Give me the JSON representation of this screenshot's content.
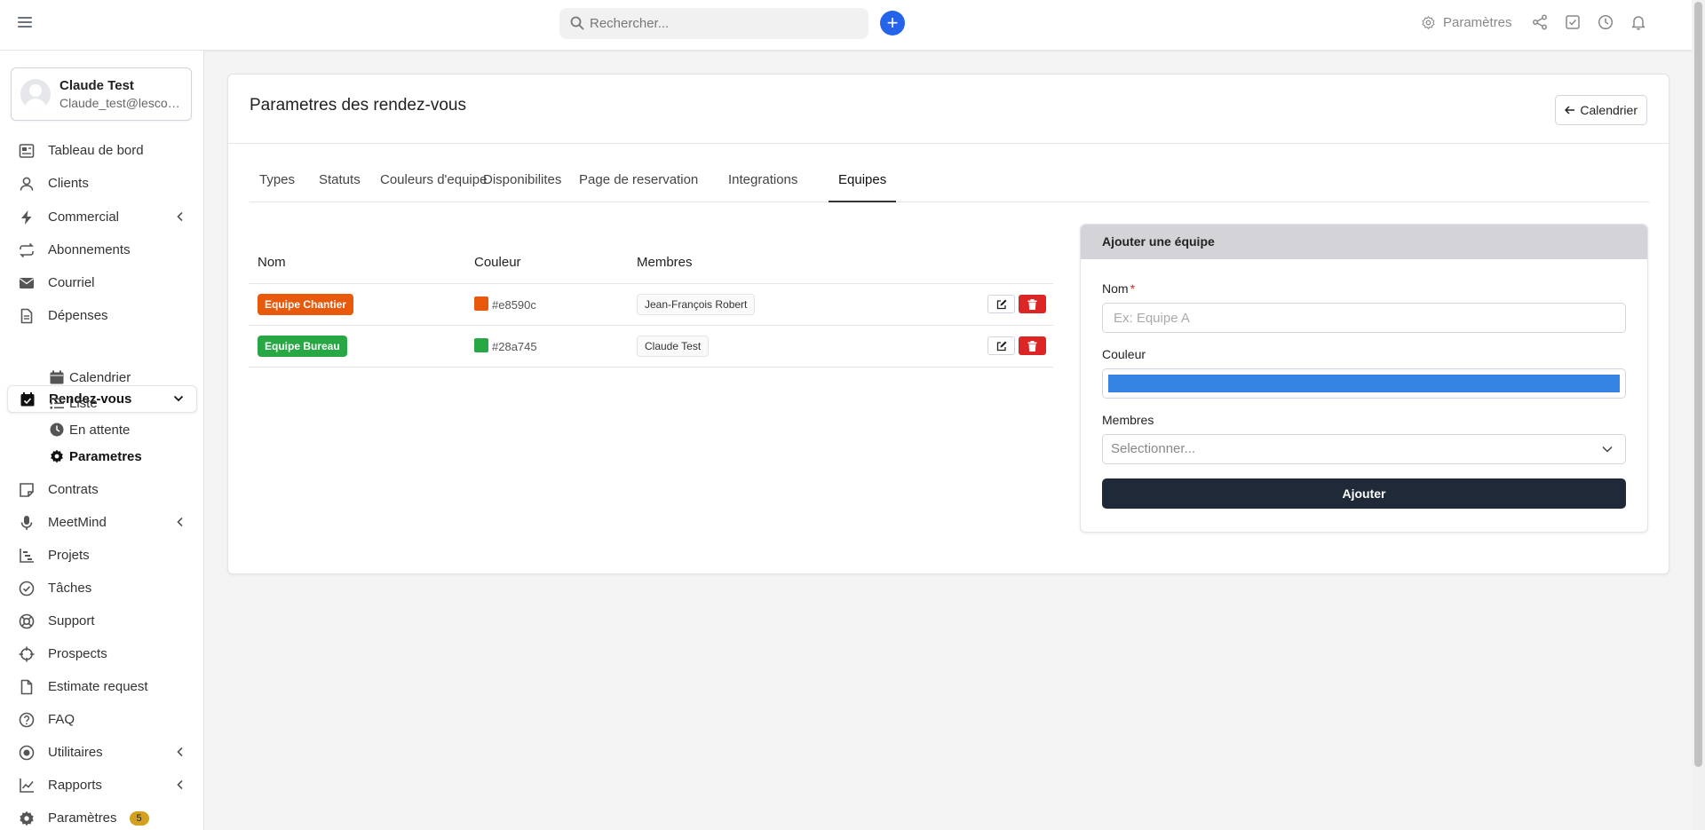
{
  "topbar": {
    "search_placeholder": "Rechercher...",
    "settings_label": "Paramètres"
  },
  "user": {
    "name": "Claude Test",
    "email": "Claude_test@lescom..."
  },
  "sidebar": {
    "items": [
      {
        "label": "Tableau de bord",
        "icon": "dashboard-icon"
      },
      {
        "label": "Clients",
        "icon": "user-icon"
      },
      {
        "label": "Commercial",
        "icon": "bolt-icon"
      },
      {
        "label": "Abonnements",
        "icon": "repeat-icon"
      },
      {
        "label": "Courriel",
        "icon": "mail-icon"
      },
      {
        "label": "Dépenses",
        "icon": "receipt-icon"
      },
      {
        "label": "Rendez-vous",
        "icon": "calendar-check-icon"
      },
      {
        "label": "Contrats",
        "icon": "note-icon"
      },
      {
        "label": "MeetMind",
        "icon": "microphone-icon"
      },
      {
        "label": "Projets",
        "icon": "chart-steps-icon"
      },
      {
        "label": "Tâches",
        "icon": "check-circle-icon"
      },
      {
        "label": "Support",
        "icon": "lifebuoy-icon"
      },
      {
        "label": "Prospects",
        "icon": "crosshair-icon"
      },
      {
        "label": "Estimate request",
        "icon": "file-icon"
      },
      {
        "label": "FAQ",
        "icon": "question-icon"
      },
      {
        "label": "Utilitaires",
        "icon": "radio-icon"
      },
      {
        "label": "Rapports",
        "icon": "line-chart-icon"
      },
      {
        "label": "Paramètres",
        "icon": "gear-icon",
        "badge": "5"
      }
    ],
    "sub_items": [
      {
        "label": "Calendrier",
        "icon": "calendar-icon"
      },
      {
        "label": "Liste",
        "icon": "list-icon"
      },
      {
        "label": "En attente",
        "icon": "clock-icon"
      },
      {
        "label": "Parametres",
        "icon": "gear-icon"
      }
    ]
  },
  "page": {
    "title": "Parametres des rendez-vous",
    "back_button": "Calendrier"
  },
  "tabs": [
    "Types",
    "Statuts",
    "Couleurs d'equipe",
    "Disponibilites",
    "Page de reservation",
    "Integrations",
    "Equipes"
  ],
  "active_tab": "Equipes",
  "table": {
    "headers": [
      "Nom",
      "Couleur",
      "Membres"
    ],
    "rows": [
      {
        "name": "Equipe Chantier",
        "color": "#e8590c",
        "members": [
          "Jean-François Robert"
        ]
      },
      {
        "name": "Equipe Bureau",
        "color": "#28a745",
        "members": [
          "Claude Test"
        ]
      }
    ]
  },
  "add_form": {
    "title": "Ajouter une équipe",
    "name_label": "Nom",
    "required_mark": "*",
    "name_placeholder": "Ex: Equipe A",
    "color_label": "Couleur",
    "color_value": "#3584e4",
    "members_label": "Membres",
    "members_placeholder": "Selectionner...",
    "submit_label": "Ajouter"
  },
  "colors": {
    "accent": "#2563eb",
    "dark_button": "#1f2937",
    "delete": "#dc2626",
    "badge": "#d4a020"
  }
}
